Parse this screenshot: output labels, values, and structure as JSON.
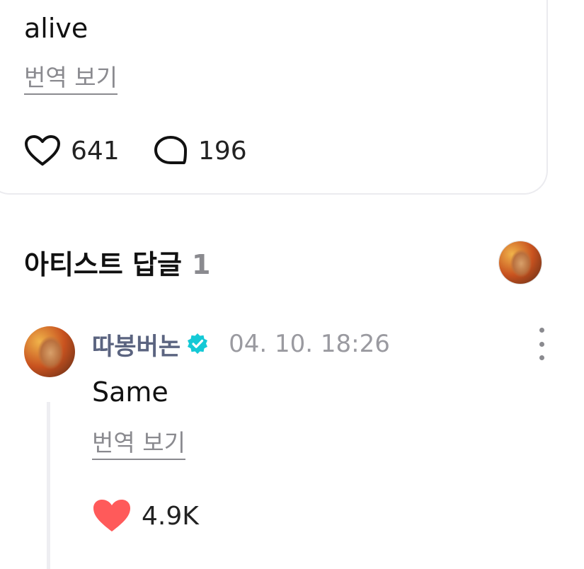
{
  "post": {
    "text": "alive",
    "translate_label": "번역 보기",
    "likes": "641",
    "comments": "196"
  },
  "replies_section": {
    "title": "아티스트 답글",
    "count": "1"
  },
  "comment": {
    "author": "따봉버논",
    "time": "04. 10. 18:26",
    "text": "Same",
    "translate_label": "번역 보기",
    "likes": "4.9K"
  },
  "icons": {
    "post_like": "heart-outline-icon",
    "post_comment": "speech-bubble-icon",
    "verified": "verified-badge-icon",
    "more": "more-vertical-icon",
    "comment_like": "heart-filled-icon"
  },
  "colors": {
    "like_red": "#ff5a5a",
    "verified_teal": "#14c9d6",
    "author_name": "#5b6480",
    "muted_text": "#8a8a8f"
  }
}
